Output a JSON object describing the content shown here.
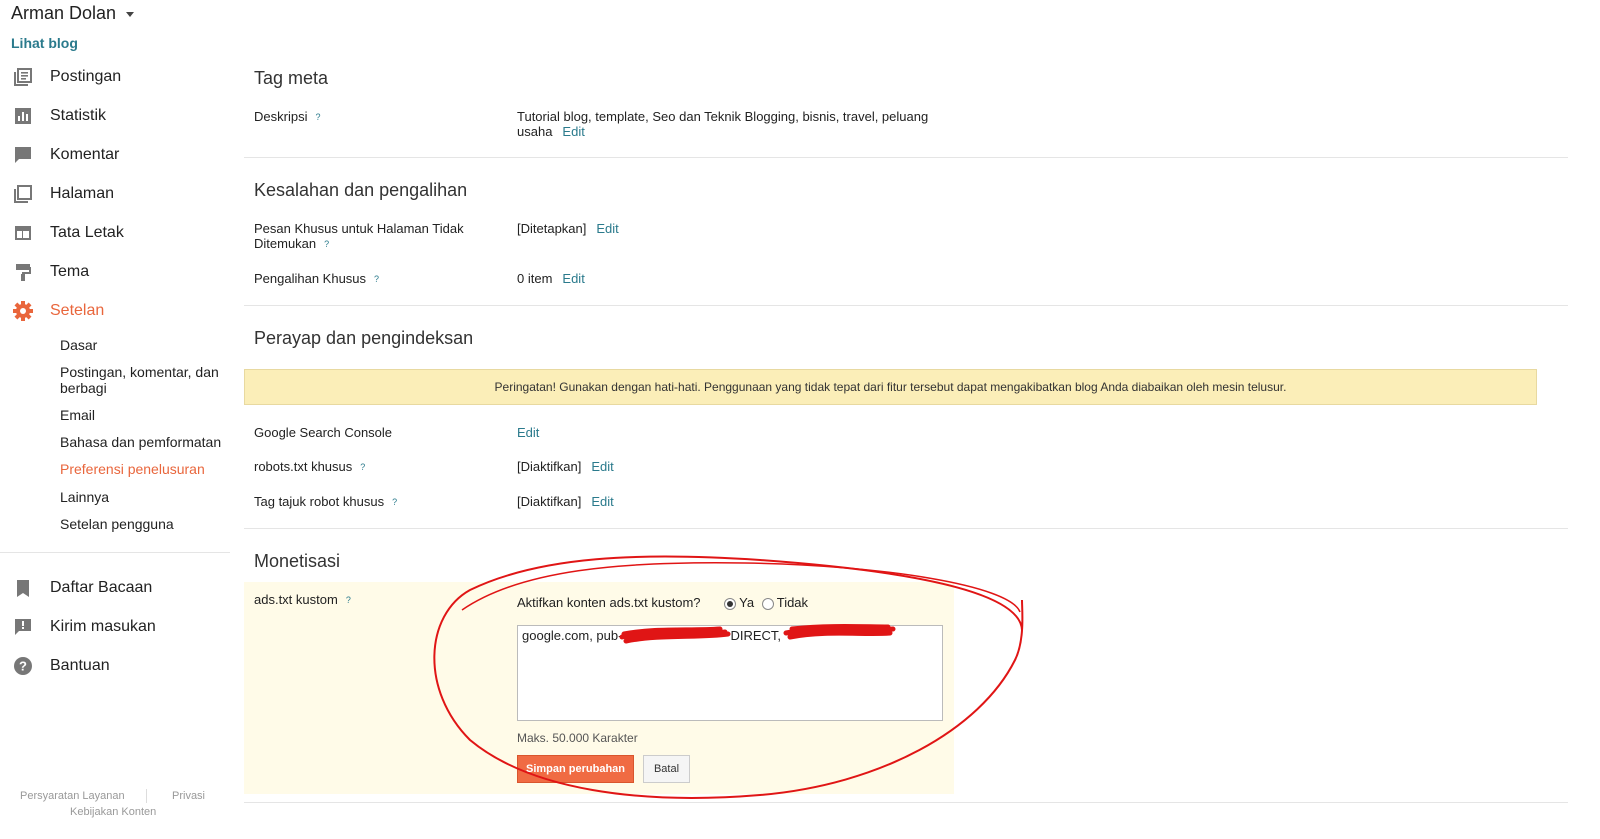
{
  "header": {
    "user_name": "Arman Dolan",
    "view_blog": "Lihat blog"
  },
  "sidebar": {
    "items": [
      {
        "label": "Postingan",
        "icon": "posts-icon"
      },
      {
        "label": "Statistik",
        "icon": "stats-icon"
      },
      {
        "label": "Komentar",
        "icon": "comment-icon"
      },
      {
        "label": "Halaman",
        "icon": "pages-icon"
      },
      {
        "label": "Tata Letak",
        "icon": "layout-icon"
      },
      {
        "label": "Tema",
        "icon": "theme-icon"
      },
      {
        "label": "Setelan",
        "icon": "gear-icon",
        "active": true
      }
    ],
    "subitems": [
      "Dasar",
      "Postingan, komentar, dan berbagi",
      "Email",
      "Bahasa dan pemformatan",
      "Preferensi penelusuran",
      "Lainnya",
      "Setelan pengguna"
    ],
    "active_subitem": "Preferensi penelusuran",
    "bottom_items": [
      {
        "label": "Daftar Bacaan",
        "icon": "bookmark-icon"
      },
      {
        "label": "Kirim masukan",
        "icon": "feedback-icon"
      },
      {
        "label": "Bantuan",
        "icon": "help-icon"
      }
    ],
    "footer": {
      "terms": "Persyaratan Layanan",
      "privacy": "Privasi",
      "content_policy": "Kebijakan Konten"
    }
  },
  "colors": {
    "accent": "#e9663c",
    "link": "#2a7a8c",
    "warning_bg": "#fbeeb8",
    "highlight_bg": "#fffbe8",
    "annotation": "#e01515"
  },
  "meta": {
    "title": "Tag meta",
    "description_label": "Deskripsi",
    "description_value_line1": "Tutorial blog, template, Seo dan Teknik Blogging, bisnis, travel, peluang",
    "description_value_line2": "usaha",
    "edit": "Edit",
    "help": "?"
  },
  "errors": {
    "title": "Kesalahan dan pengalihan",
    "not_found_label_line1": "Pesan Khusus untuk Halaman Tidak",
    "not_found_label_line2": "Ditemukan",
    "not_found_value": "[Ditetapkan]",
    "redirect_label": "Pengalihan Khusus",
    "redirect_value": "0 item"
  },
  "crawl": {
    "title": "Perayap dan pengindeksan",
    "warning": "Peringatan! Gunakan dengan hati-hati. Penggunaan yang tidak tepat dari fitur tersebut dapat mengakibatkan blog Anda diabaikan oleh mesin telusur.",
    "console_label": "Google Search Console",
    "robots_label": "robots.txt khusus",
    "robots_value": "[Diaktifkan]",
    "robot_tags_label": "Tag tajuk robot khusus",
    "robot_tags_value": "[Diaktifkan]"
  },
  "monetization": {
    "title": "Monetisasi",
    "ads_label": "ads.txt kustom",
    "question": "Aktifkan konten ads.txt kustom?",
    "yes": "Ya",
    "no": "Tidak",
    "selected": "Ya",
    "ads_value": "google.com, pub-",
    "ads_value_mid": "DIRECT,",
    "hint": "Maks. 50.000 Karakter",
    "save": "Simpan perubahan",
    "cancel": "Batal"
  }
}
